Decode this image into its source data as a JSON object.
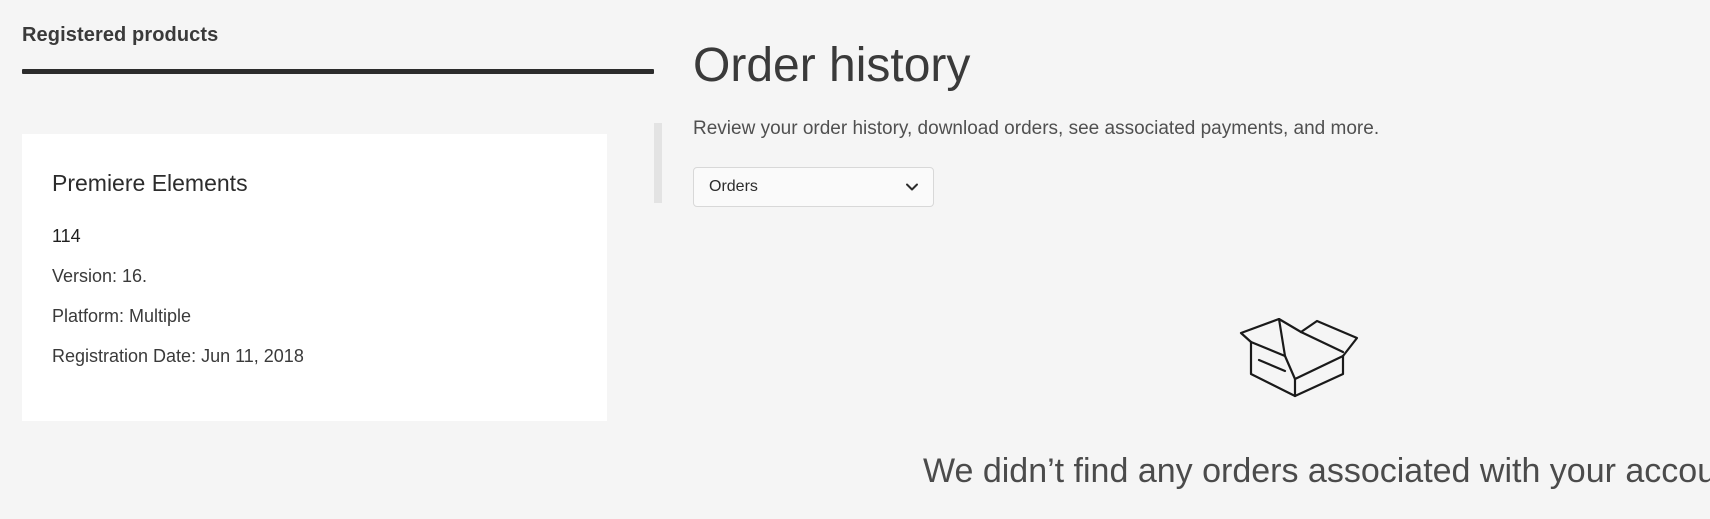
{
  "registered_products": {
    "tab_label": "Registered products",
    "product": {
      "name": "Premiere Elements",
      "id": "114",
      "version": "Version: 16.",
      "platform": "Platform: Multiple",
      "registration_date": "Registration Date: Jun 11, 2018"
    }
  },
  "order_history": {
    "title": "Order history",
    "description": "Review your order history, download orders, see associated payments, and more.",
    "filter": {
      "selected": "Orders",
      "icon": "chevron-down-icon"
    },
    "empty_state": {
      "icon": "open-box-icon",
      "message": "We didn’t find any orders associated with your account."
    }
  }
}
